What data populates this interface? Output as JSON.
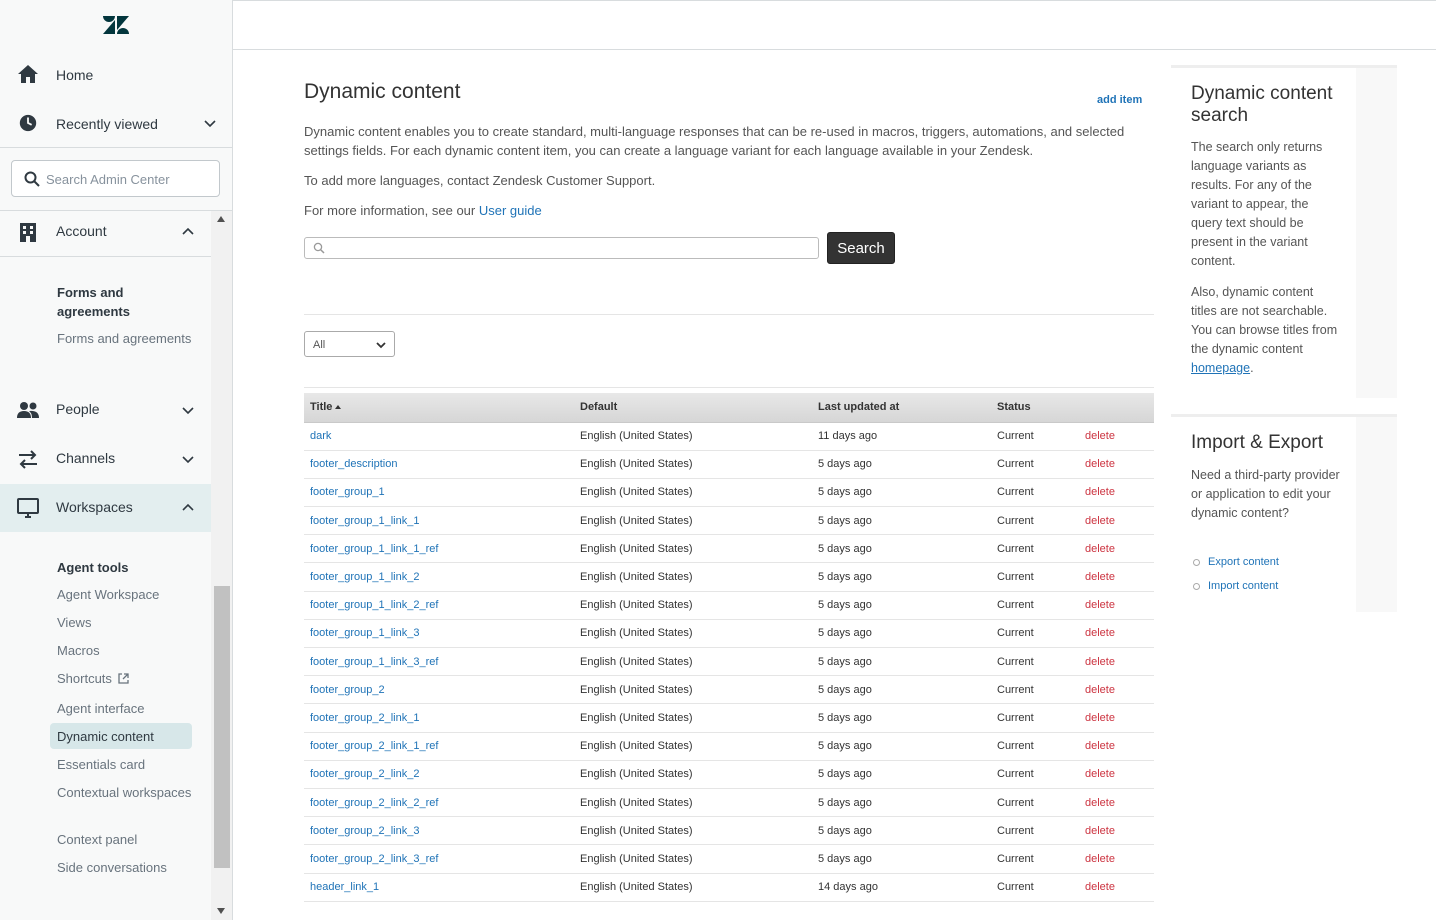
{
  "sidebar": {
    "home_label": "Home",
    "recently_viewed_label": "Recently viewed",
    "search_placeholder": "Search Admin Center",
    "sections": {
      "account": "Account",
      "people": "People",
      "channels": "Channels",
      "workspaces": "Workspaces"
    },
    "account_sub": {
      "heading": "Forms and agreements",
      "item": "Forms and agreements"
    },
    "workspaces_sub": {
      "heading": "Agent tools",
      "items": [
        "Agent Workspace",
        "Views",
        "Macros",
        "Shortcuts",
        "Agent interface",
        "Dynamic content",
        "Essentials card",
        "Contextual workspaces",
        "Context panel",
        "Side conversations"
      ],
      "selected": "Dynamic content"
    }
  },
  "main": {
    "title": "Dynamic content",
    "add_item_label": "add item",
    "description": "Dynamic content enables you to create standard, multi-language responses that can be re-used in macros, triggers, automations, and selected settings fields. For each dynamic content item, you can create a language variant for each language available in your Zendesk.",
    "languages_note": "To add more languages, contact Zendesk Customer Support.",
    "more_info_prefix": "For more information, see our ",
    "user_guide_link": "User guide",
    "search_value": "",
    "search_button": "Search",
    "filter_selected": "All",
    "table": {
      "headers": [
        "Title",
        "Default",
        "Last updated at",
        "Status",
        ""
      ],
      "rows": [
        {
          "title": "dark",
          "default": "English (United States)",
          "updated": "11 days ago",
          "status": "Current",
          "action": "delete"
        },
        {
          "title": "footer_description",
          "default": "English (United States)",
          "updated": "5 days ago",
          "status": "Current",
          "action": "delete"
        },
        {
          "title": "footer_group_1",
          "default": "English (United States)",
          "updated": "5 days ago",
          "status": "Current",
          "action": "delete"
        },
        {
          "title": "footer_group_1_link_1",
          "default": "English (United States)",
          "updated": "5 days ago",
          "status": "Current",
          "action": "delete"
        },
        {
          "title": "footer_group_1_link_1_ref",
          "default": "English (United States)",
          "updated": "5 days ago",
          "status": "Current",
          "action": "delete"
        },
        {
          "title": "footer_group_1_link_2",
          "default": "English (United States)",
          "updated": "5 days ago",
          "status": "Current",
          "action": "delete"
        },
        {
          "title": "footer_group_1_link_2_ref",
          "default": "English (United States)",
          "updated": "5 days ago",
          "status": "Current",
          "action": "delete"
        },
        {
          "title": "footer_group_1_link_3",
          "default": "English (United States)",
          "updated": "5 days ago",
          "status": "Current",
          "action": "delete"
        },
        {
          "title": "footer_group_1_link_3_ref",
          "default": "English (United States)",
          "updated": "5 days ago",
          "status": "Current",
          "action": "delete"
        },
        {
          "title": "footer_group_2",
          "default": "English (United States)",
          "updated": "5 days ago",
          "status": "Current",
          "action": "delete"
        },
        {
          "title": "footer_group_2_link_1",
          "default": "English (United States)",
          "updated": "5 days ago",
          "status": "Current",
          "action": "delete"
        },
        {
          "title": "footer_group_2_link_1_ref",
          "default": "English (United States)",
          "updated": "5 days ago",
          "status": "Current",
          "action": "delete"
        },
        {
          "title": "footer_group_2_link_2",
          "default": "English (United States)",
          "updated": "5 days ago",
          "status": "Current",
          "action": "delete"
        },
        {
          "title": "footer_group_2_link_2_ref",
          "default": "English (United States)",
          "updated": "5 days ago",
          "status": "Current",
          "action": "delete"
        },
        {
          "title": "footer_group_2_link_3",
          "default": "English (United States)",
          "updated": "5 days ago",
          "status": "Current",
          "action": "delete"
        },
        {
          "title": "footer_group_2_link_3_ref",
          "default": "English (United States)",
          "updated": "5 days ago",
          "status": "Current",
          "action": "delete"
        },
        {
          "title": "header_link_1",
          "default": "English (United States)",
          "updated": "14 days ago",
          "status": "Current",
          "action": "delete"
        }
      ]
    }
  },
  "search_panel": {
    "title": "Dynamic content search",
    "para1": "The search only returns language variants as results. For any of the variant to appear, the query text should be present in the variant content.",
    "para2_prefix": "Also, dynamic content titles are not searchable. You can browse titles from the dynamic content ",
    "para2_link": "homepage",
    "para2_suffix": "."
  },
  "import_export_panel": {
    "title": "Import & Export",
    "para": "Need a third-party provider or application to edit your dynamic content?",
    "links": [
      "Export content",
      "Import content"
    ]
  },
  "colors": {
    "link": "#1f73b7",
    "delete": "#cc3340",
    "selected_nav": "#d7e7e9",
    "active_section": "#e3eeef"
  },
  "icons": [
    "zendesk-logo",
    "home-icon",
    "clock-icon",
    "chevron-down-icon",
    "chevron-up-icon",
    "search-icon",
    "building-icon",
    "people-icon",
    "arrows-icon",
    "monitor-icon",
    "external-link-icon"
  ]
}
